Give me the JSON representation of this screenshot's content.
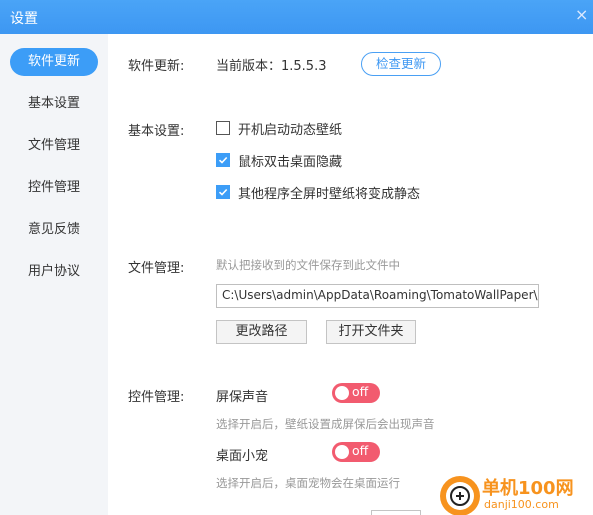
{
  "window": {
    "title": "设置",
    "close_glyph": "×"
  },
  "sidebar": {
    "items": [
      {
        "label": "软件更新",
        "active": true
      },
      {
        "label": "基本设置",
        "active": false
      },
      {
        "label": "文件管理",
        "active": false
      },
      {
        "label": "控件管理",
        "active": false
      },
      {
        "label": "意见反馈",
        "active": false
      },
      {
        "label": "用户协议",
        "active": false
      }
    ]
  },
  "update": {
    "label": "软件更新:",
    "version_text": "当前版本：1.5.5.3",
    "check_button": "检查更新"
  },
  "basic": {
    "label": "基本设置:",
    "options": [
      {
        "label": "开机启动动态壁纸",
        "checked": false
      },
      {
        "label": "鼠标双击桌面隐藏",
        "checked": true
      },
      {
        "label": "其他程序全屏时壁纸将变成静态",
        "checked": true
      }
    ]
  },
  "files": {
    "label": "文件管理:",
    "hint": "默认把接收到的文件保存到此文件中",
    "path": "C:\\Users\\admin\\AppData\\Roaming\\TomatoWallPaper\\d",
    "change_button": "更改路径",
    "open_button": "打开文件夹"
  },
  "controls": {
    "label": "控件管理:",
    "items": [
      {
        "label": "屏保声音",
        "state": "off",
        "hint": "选择开启后，壁纸设置成屏保后会出现声音"
      },
      {
        "label": "桌面小宠",
        "state": "off",
        "hint": "选择开启后，桌面宠物会在桌面运行"
      }
    ]
  },
  "watermark": {
    "brand": "单机100网",
    "site": "danji100.com"
  },
  "colors": {
    "accent": "#3c9df7",
    "toggle_off": "#f25b6f",
    "brand_orange": "#f7931e"
  }
}
